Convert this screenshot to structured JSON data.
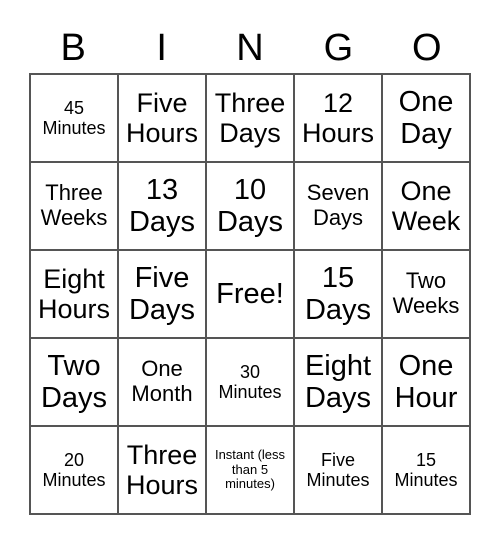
{
  "header": [
    "B",
    "I",
    "N",
    "G",
    "O"
  ],
  "cells": [
    [
      {
        "text": "45 Minutes",
        "size": "sm"
      },
      {
        "text": "Five Hours",
        "size": "lg"
      },
      {
        "text": "Three Days",
        "size": "lg"
      },
      {
        "text": "12 Hours",
        "size": "lg"
      },
      {
        "text": "One Day",
        "size": "xl"
      }
    ],
    [
      {
        "text": "Three Weeks",
        "size": "md"
      },
      {
        "text": "13 Days",
        "size": "xl"
      },
      {
        "text": "10 Days",
        "size": "xl"
      },
      {
        "text": "Seven Days",
        "size": "md"
      },
      {
        "text": "One Week",
        "size": "lg"
      }
    ],
    [
      {
        "text": "Eight Hours",
        "size": "lg"
      },
      {
        "text": "Five Days",
        "size": "xl"
      },
      {
        "text": "Free!",
        "size": "xl"
      },
      {
        "text": "15 Days",
        "size": "xl"
      },
      {
        "text": "Two Weeks",
        "size": "md"
      }
    ],
    [
      {
        "text": "Two Days",
        "size": "xl"
      },
      {
        "text": "One Month",
        "size": "md"
      },
      {
        "text": "30 Minutes",
        "size": "sm"
      },
      {
        "text": "Eight Days",
        "size": "xl"
      },
      {
        "text": "One Hour",
        "size": "xl"
      }
    ],
    [
      {
        "text": "20 Minutes",
        "size": "sm"
      },
      {
        "text": "Three Hours",
        "size": "lg"
      },
      {
        "text": "Instant (less than 5 minutes)",
        "size": "xs"
      },
      {
        "text": "Five Minutes",
        "size": "sm"
      },
      {
        "text": "15 Minutes",
        "size": "sm"
      }
    ]
  ]
}
